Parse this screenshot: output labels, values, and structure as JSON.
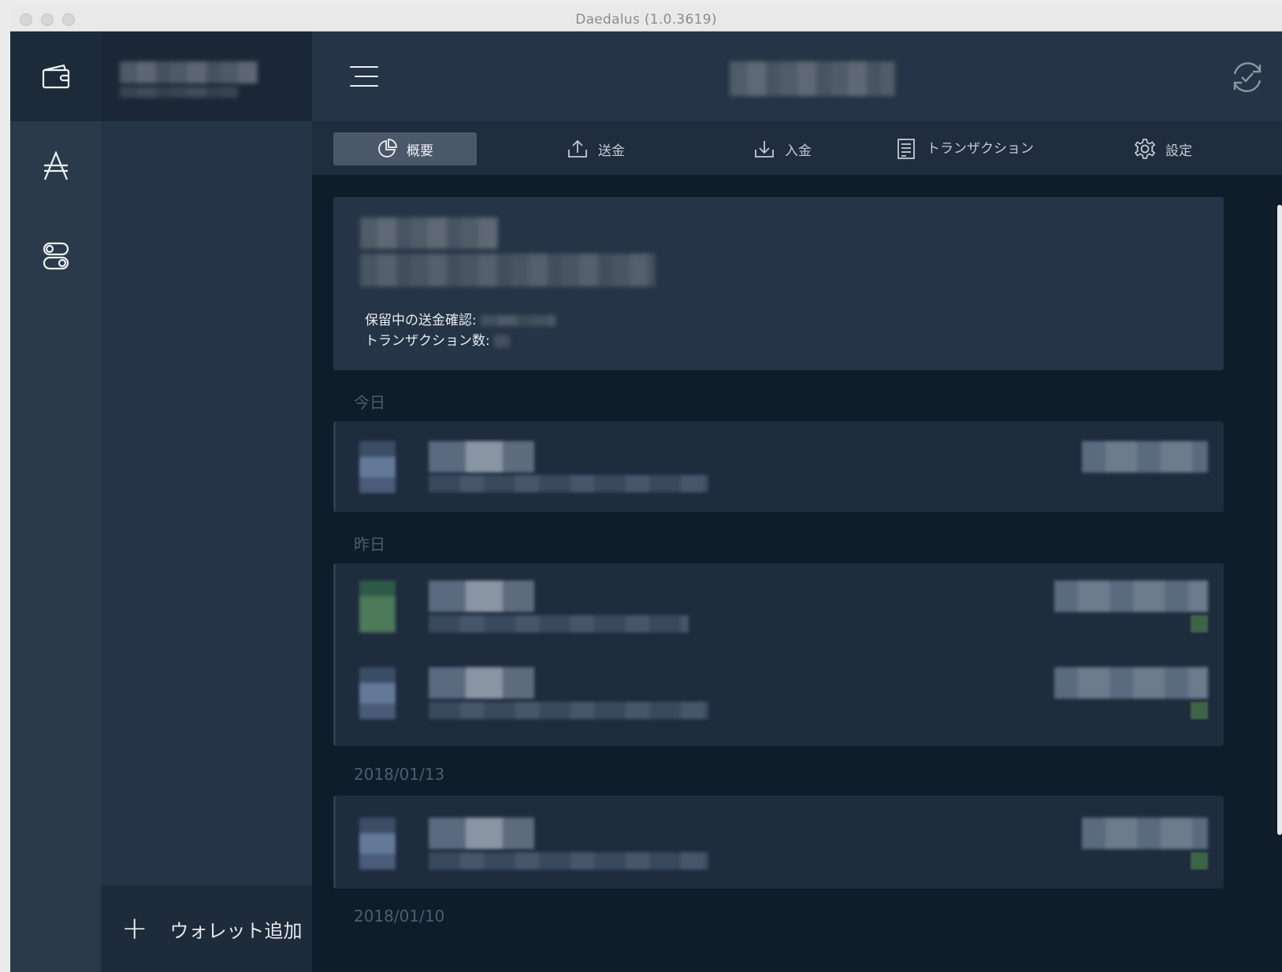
{
  "window": {
    "title": "Daedalus (1.0.3619)"
  },
  "rail": {
    "items": [
      "wallet-icon",
      "ada-icon",
      "settings-toggle-icon"
    ]
  },
  "wallets": {
    "add_label": "ウォレット追加"
  },
  "tabs": [
    {
      "label": "概要",
      "icon": "summary-icon"
    },
    {
      "label": "送金",
      "icon": "send-icon"
    },
    {
      "label": "入金",
      "icon": "receive-icon"
    },
    {
      "label": "トランザクション",
      "icon": "transactions-icon"
    },
    {
      "label": "設定",
      "icon": "gear-icon"
    }
  ],
  "summary": {
    "pending_label": "保留中の送金確認:",
    "tx_count_label": "トランザクション数:"
  },
  "groups": [
    "今日",
    "昨日",
    "2018/01/13",
    "2018/01/10"
  ],
  "colors": {
    "background": "#0f1c29",
    "panel": "#253446",
    "tab_active": "#4a5869"
  }
}
